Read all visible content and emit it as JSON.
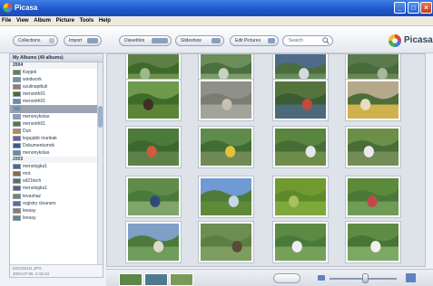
{
  "window": {
    "title": "Picasa"
  },
  "menu": [
    "File",
    "View",
    "Album",
    "Picture",
    "Tools",
    "Help"
  ],
  "toolbar": {
    "collections_label": "Collections",
    "import_label": "Import",
    "slideshow_label": "Diavetítés",
    "toolbar_btn2_label": "Slideshow",
    "edit_label": "Edit Pictures",
    "search_placeholder": "Search",
    "logo_text": "Picasa"
  },
  "sidebar": {
    "header": "My Albums (49 albums)",
    "groups": [
      {
        "year": "2004",
        "items": [
          {
            "label": "Kepjek",
            "color": "#5b8a3a"
          },
          {
            "label": "windwork",
            "color": "#7894a8"
          },
          {
            "label": "szulinapibuli",
            "color": "#a07a5a"
          },
          {
            "label": "menonth01",
            "color": "#4d6b2f"
          },
          {
            "label": "menonth01",
            "color": "#6b8fa6"
          },
          {
            "label": "",
            "color": "#7a8aa0",
            "selected": true
          },
          {
            "label": "menonykolas",
            "color": "#8aa0b6"
          },
          {
            "label": "menonth01",
            "color": "#5a7b3a"
          },
          {
            "label": "Duó",
            "color": "#c08a40"
          },
          {
            "label": "legujabb munkak",
            "color": "#7a5aa0"
          },
          {
            "label": "Dokumentumok",
            "color": "#3a5a8a"
          },
          {
            "label": "menonykolas",
            "color": "#6a8a9a"
          }
        ]
      },
      {
        "year": "2003",
        "items": [
          {
            "label": "menolsgka1",
            "color": "#4a6a8a"
          },
          {
            "label": "mot",
            "color": "#8a6a4a"
          },
          {
            "label": "sd21tech",
            "color": "#4a7a5a"
          },
          {
            "label": "menolsgka1",
            "color": "#6a5a7a"
          },
          {
            "label": "tevashaz",
            "color": "#7a8a4a"
          },
          {
            "label": "registry cleaners",
            "color": "#5a6a9a"
          },
          {
            "label": "leesay",
            "color": "#9a7a5a"
          },
          {
            "label": "leesay",
            "color": "#5a8a8a"
          }
        ]
      }
    ],
    "footer": [
      "DSC03411.JPG",
      "2004.07.05. 2:15:13"
    ]
  },
  "photos": [
    {
      "sky": "#5d7f45",
      "mid": "#3d6a2b",
      "ground": "#6f8f4a",
      "accent": "#9fb88a"
    },
    {
      "sky": "#6c8e5a",
      "mid": "#4a7040",
      "ground": "#7d9b6a",
      "accent": "#c9d2c0"
    },
    {
      "sky": "#4f6b8a",
      "mid": "#4a6d3f",
      "ground": "#6a8b5c",
      "accent": "#d7d9e0"
    },
    {
      "sky": "#5b7a4c",
      "mid": "#456c3a",
      "ground": "#6b8550",
      "accent": "#a7b89c"
    },
    {
      "sky": "#6f9a4d",
      "mid": "#3e6d2a",
      "ground": "#5c8436",
      "accent": "#3f2f25"
    },
    {
      "sky": "#8f9188",
      "mid": "#7b7d74",
      "ground": "#a2a399",
      "accent": "#c8c0b0"
    },
    {
      "sky": "#55733c",
      "mid": "#3b5c32",
      "ground": "#4a6a7a",
      "accent": "#c24a3a"
    },
    {
      "sky": "#b5a98c",
      "mid": "#4f6d3b",
      "ground": "#d0b24c",
      "accent": "#e8dcc0"
    },
    {
      "sky": "#4c7a3a",
      "mid": "#3c6830",
      "ground": "#5d8248",
      "accent": "#d35a3a"
    },
    {
      "sky": "#5e8b4a",
      "mid": "#3f6d33",
      "ground": "#6f8a54",
      "accent": "#e3c23a"
    },
    {
      "sky": "#59853e",
      "mid": "#476c35",
      "ground": "#6e8c4a",
      "accent": "#e6e6ea"
    },
    {
      "sky": "#6c8f48",
      "mid": "#4a6c36",
      "ground": "#748d58",
      "accent": "#eaeaee"
    },
    {
      "sky": "#5f8a4a",
      "mid": "#4a7a3a",
      "ground": "#7fa56a",
      "accent": "#2f4a7a"
    },
    {
      "sky": "#6f9ad3",
      "mid": "#4f7b3a",
      "ground": "#5f8a3a",
      "accent": "#c9d6e6"
    },
    {
      "sky": "#6f9a2f",
      "mid": "#5d8a2a",
      "ground": "#7ea83a",
      "accent": "#a9c060"
    },
    {
      "sky": "#5a8a3a",
      "mid": "#4a7838",
      "ground": "#6e9c54",
      "accent": "#c04a4a"
    },
    {
      "sky": "#7ea0c6",
      "mid": "#4c7a3c",
      "ground": "#6f9d5c",
      "accent": "#e0d8c8"
    },
    {
      "sky": "#6c8e52",
      "mid": "#5c7e44",
      "ground": "#7d9e60",
      "accent": "#5a4a3a"
    },
    {
      "sky": "#5c8a44",
      "mid": "#4a7a3a",
      "ground": "#76a05a",
      "accent": "#efeff2"
    },
    {
      "sky": "#5f8c44",
      "mid": "#467536",
      "ground": "#7ca863",
      "accent": "#f0f0f0"
    }
  ],
  "tray": {
    "colors": [
      "#5e8648",
      "#4f7a8e",
      "#7a9a5a"
    ]
  }
}
